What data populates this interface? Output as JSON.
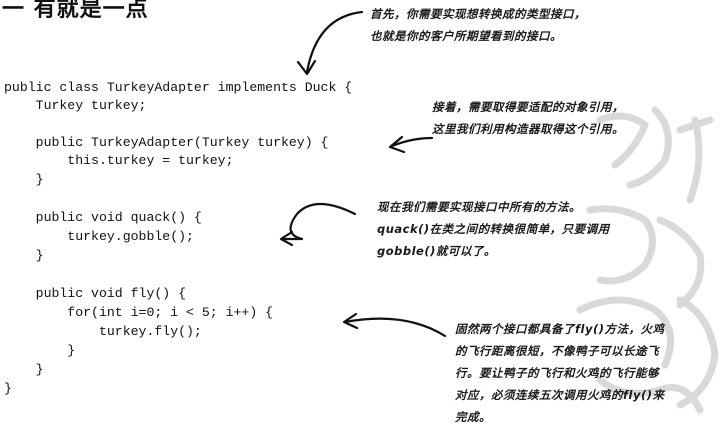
{
  "heading": "一 有就是一点",
  "code": {
    "lines": [
      "public class TurkeyAdapter implements Duck {",
      "    Turkey turkey;",
      "    public TurkeyAdapter(Turkey turkey) {",
      "        this.turkey = turkey;",
      "    }",
      "    public void quack() {",
      "        turkey.gobble();",
      "    }",
      "    public void fly() {",
      "        for(int i=0; i < 5; i++) {",
      "            turkey.fly();",
      "        }",
      "    }",
      "}"
    ]
  },
  "notes": {
    "note1": [
      "首先，你需要实现想转换成的类型接口，",
      "也就是你的客户所期望看到的接口。"
    ],
    "note2": [
      "接着，需要取得要适配的对象引用，",
      "这里我们利用构造器取得这个引用。"
    ],
    "note3": [
      "现在我们需要实现接口中所有的方法。",
      "quack()在类之间的转换很简单，只要调用",
      "gobble()就可以了。"
    ],
    "note4": [
      "固然两个接口都具备了fly()方法，火鸡",
      "的飞行距离很短，不像鸭子可以长途飞",
      "行。要让鸭子的飞行和火鸡的飞行能够",
      "对应，必须连续五次调用火鸡的fly()来",
      "完成。"
    ]
  },
  "colors": {
    "text": "#111111",
    "watermark": "#d9d9d9"
  }
}
